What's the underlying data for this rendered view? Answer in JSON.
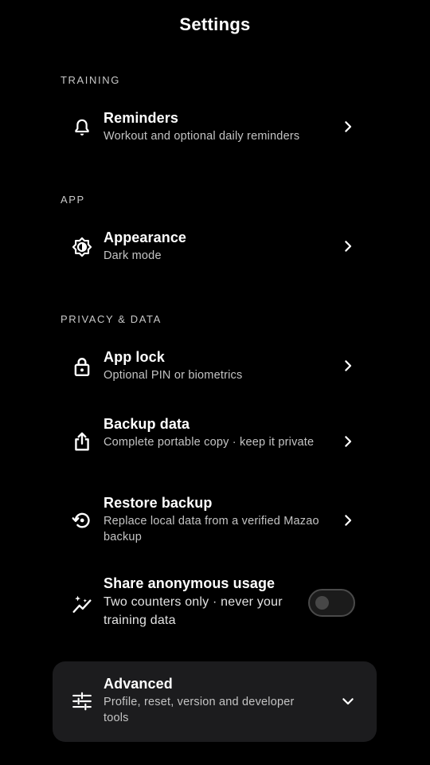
{
  "header": {
    "title": "Settings"
  },
  "sections": {
    "training": {
      "label": "TRAINING"
    },
    "app": {
      "label": "APP"
    },
    "privacy": {
      "label": "PRIVACY & DATA"
    }
  },
  "items": {
    "reminders": {
      "label": "Reminders",
      "sub": "Workout and optional daily reminders",
      "icon": "bell-icon"
    },
    "appearance": {
      "label": "Appearance",
      "sub": "Dark mode",
      "icon": "brightness-icon"
    },
    "app_lock": {
      "label": "App lock",
      "sub": "Optional PIN or biometrics",
      "icon": "lock-icon"
    },
    "backup": {
      "label": "Backup data",
      "sub": "Complete portable copy · keep it private",
      "icon": "share-upload-icon"
    },
    "restore": {
      "label": "Restore backup",
      "sub": "Replace local data from a verified Mazao backup",
      "icon": "restore-icon"
    },
    "share_usage": {
      "label": "Share anonymous usage",
      "sub": "Two counters only · never your training data",
      "icon": "sparkle-chart-icon",
      "enabled": false
    },
    "advanced": {
      "label": "Advanced",
      "sub": "Profile, reset, version and developer tools",
      "icon": "sliders-icon",
      "expanded": false
    }
  },
  "colors": {
    "background": "#000000",
    "card": "#1c1c1e",
    "text": "#ffffff",
    "subtext": "#c4c4c4"
  }
}
